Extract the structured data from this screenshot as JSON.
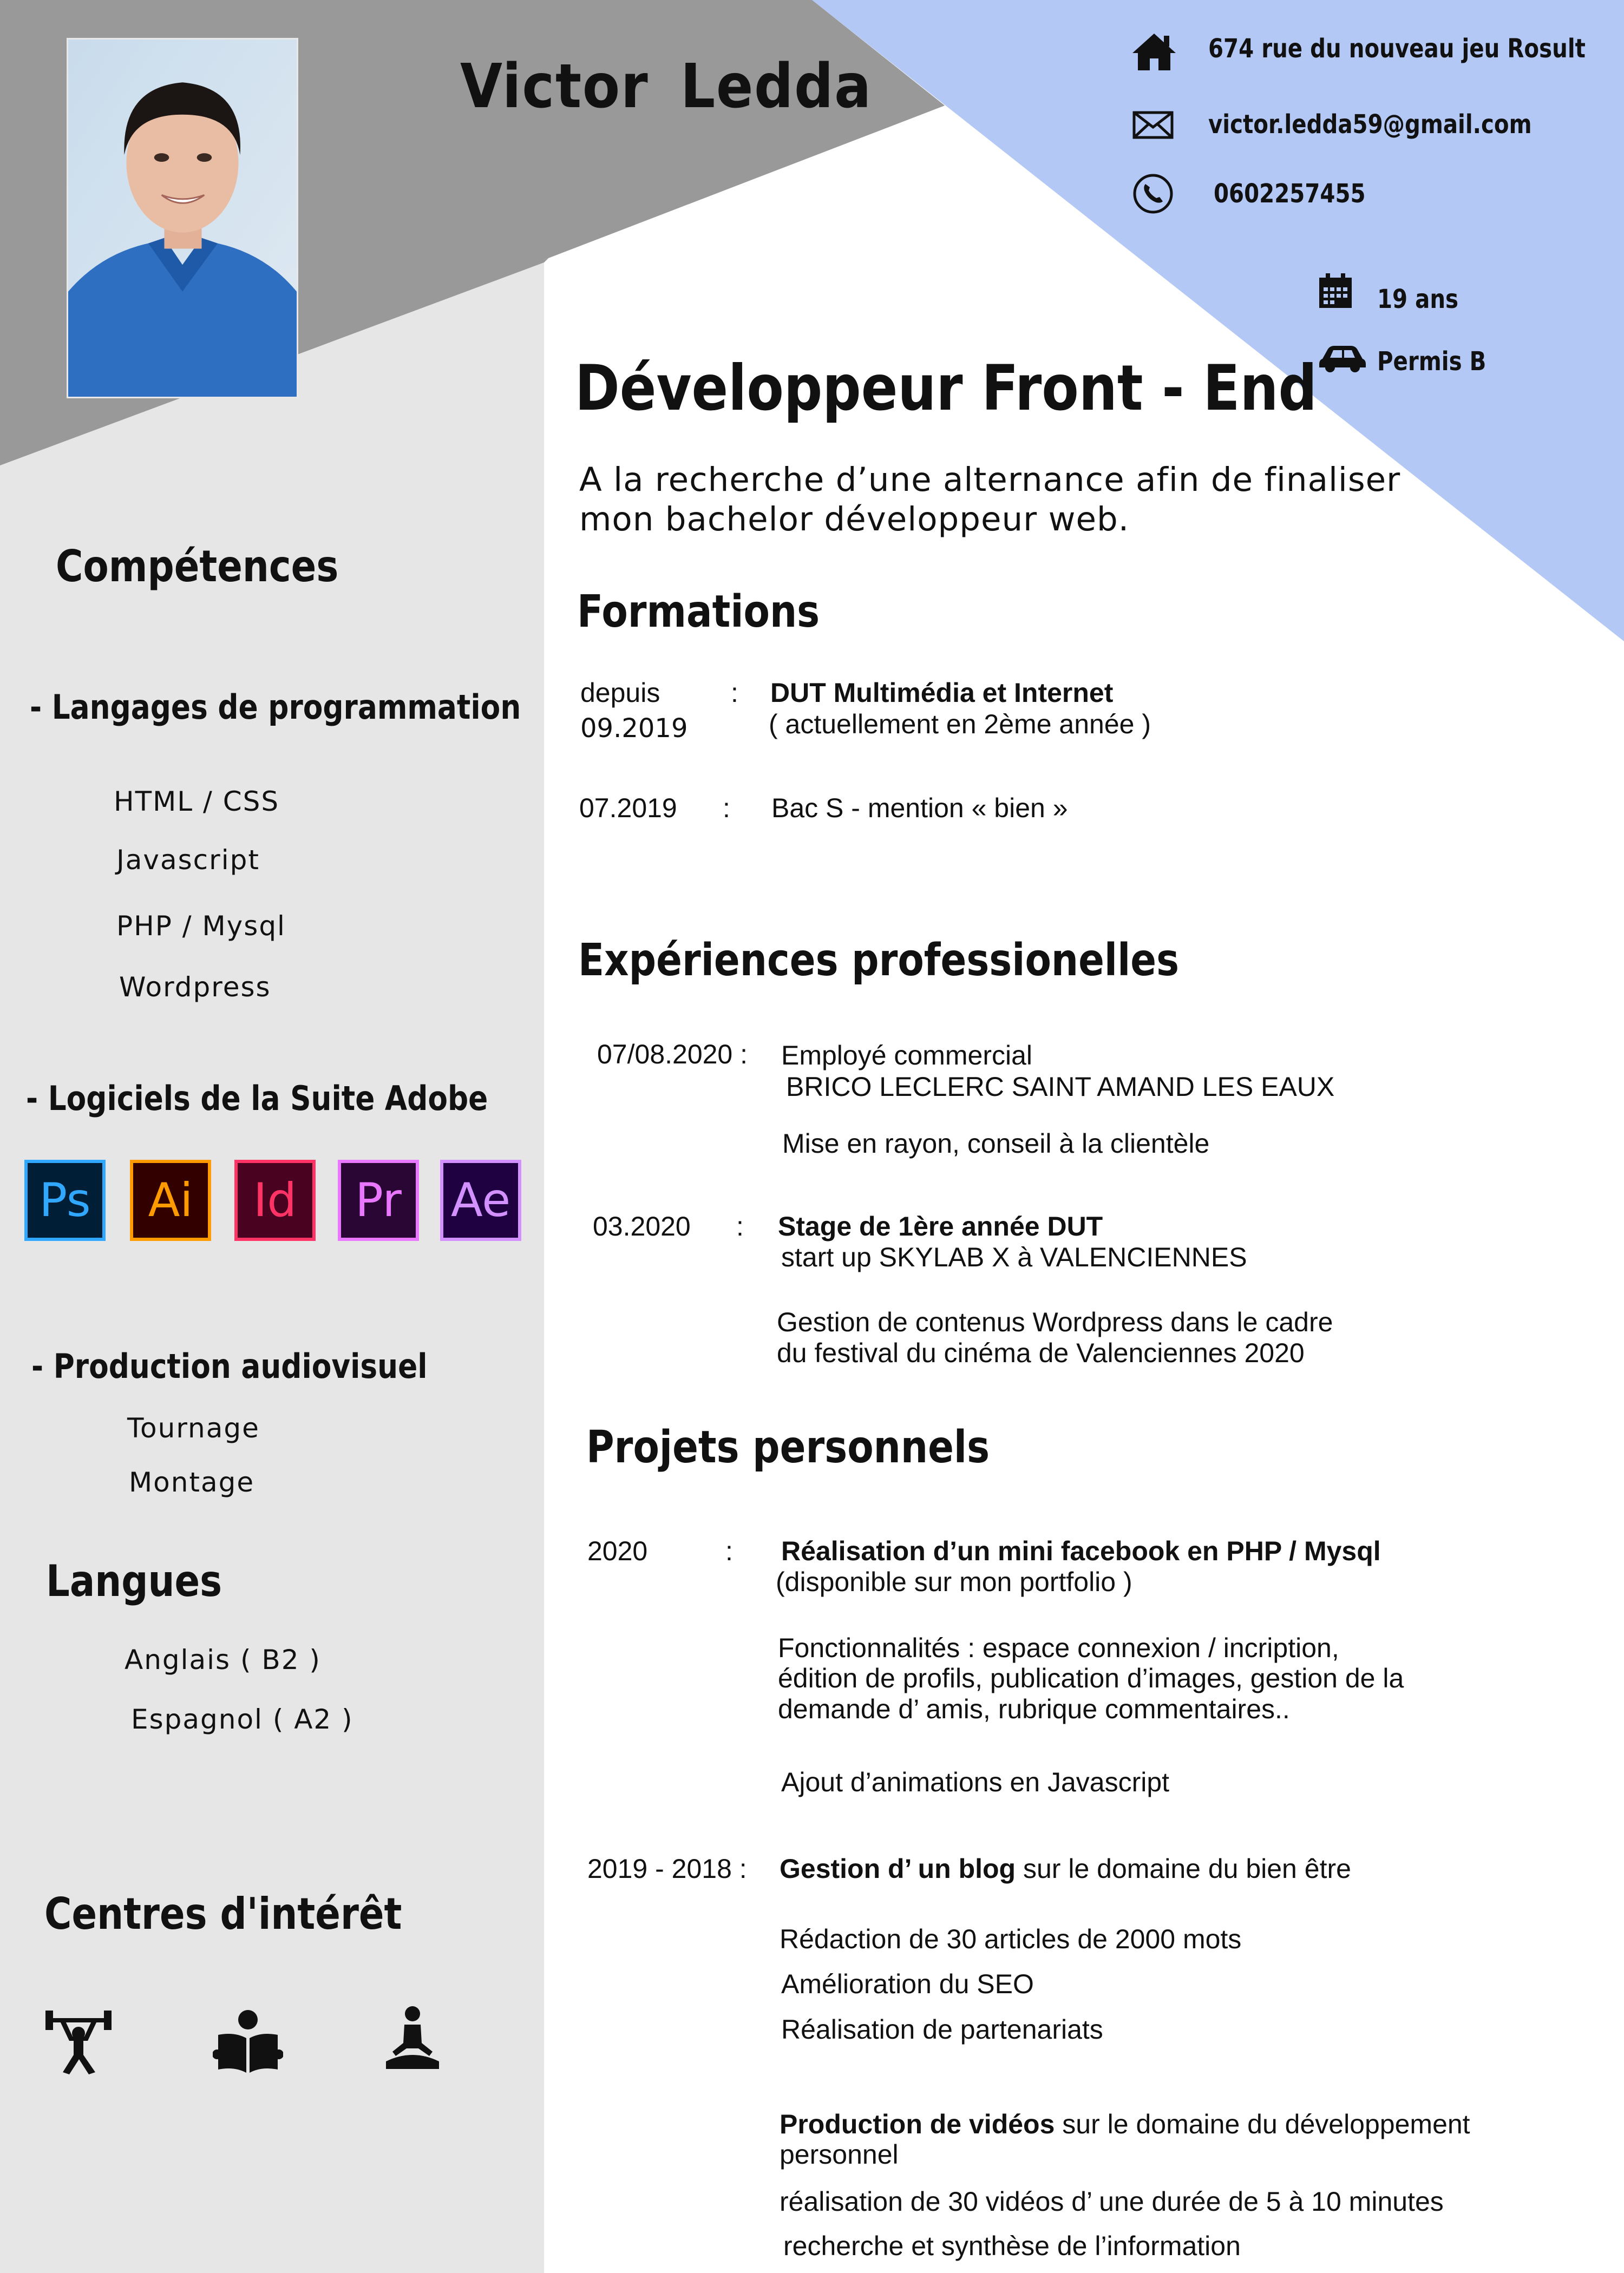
{
  "header": {
    "name": "Victor  Ledda",
    "job_title": "Développeur Front - End",
    "tagline_line1": "A la recherche d’une alternance afin de finaliser",
    "tagline_line2": "mon bachelor développeur web."
  },
  "contact": {
    "address": "674 rue du nouveau jeu Rosult",
    "email": "victor.ledda59@gmail.com",
    "phone": "0602257455",
    "age": "19 ans",
    "license": "Permis B"
  },
  "skills": {
    "heading": "Compétences",
    "programming_heading": "- Langages de programmation",
    "programming": [
      "HTML / CSS",
      "Javascript",
      "PHP / Mysql",
      "Wordpress"
    ],
    "adobe_heading": "- Logiciels de la Suite Adobe",
    "adobe": [
      {
        "label": "Ps",
        "color": "#31a8ff",
        "bg": "#001e36"
      },
      {
        "label": "Ai",
        "color": "#ff9a00",
        "bg": "#330000"
      },
      {
        "label": "Id",
        "color": "#ff3366",
        "bg": "#49021f"
      },
      {
        "label": "Pr",
        "color": "#ea77ff",
        "bg": "#2a0634"
      },
      {
        "label": "Ae",
        "color": "#d291ff",
        "bg": "#1f0040"
      }
    ],
    "av_heading": "- Production audiovisuel",
    "av": [
      "Tournage",
      "Montage"
    ]
  },
  "languages": {
    "heading": "Langues",
    "items": [
      "Anglais ( B2 )",
      "Espagnol ( A2 )"
    ]
  },
  "interests": {
    "heading": "Centres d'intérêt",
    "icons": [
      "weightlifting-icon",
      "reading-icon",
      "meditation-icon"
    ]
  },
  "formations": {
    "heading": "Formations",
    "items": [
      {
        "date1": "depuis",
        "date2": "09.2019",
        "sep": ":",
        "title": "DUT Multimédia et Internet",
        "detail": "( actuellement en 2ème année )"
      },
      {
        "date1": "07.2019",
        "sep": ":",
        "title": "Bac S - mention « bien »"
      }
    ]
  },
  "experiences": {
    "heading": "Expériences professionelles",
    "items": [
      {
        "date": "07/08.2020 :",
        "title": "Employé commercial",
        "company": "BRICO LECLERC SAINT AMAND LES EAUX",
        "desc1": "Mise en rayon, conseil à la clientèle"
      },
      {
        "date": "03.2020",
        "sep": ":",
        "title": "Stage de 1ère année DUT",
        "company": "start up SKYLAB X à VALENCIENNES",
        "desc1": "Gestion de contenus Wordpress dans le cadre",
        "desc2": "du festival du cinéma de Valenciennes 2020"
      }
    ]
  },
  "projects": {
    "heading": "Projets personnels",
    "p1": {
      "date": "2020",
      "sep": ":",
      "title": "Réalisation d’un mini facebook en PHP / Mysql",
      "subtitle": "(disponible sur mon portfolio )",
      "desc": [
        "Fonctionnalités : espace connexion / incription,",
        "édition de profils, publication d’images, gestion de la",
        "demande d’ amis, rubrique commentaires.."
      ],
      "extra": "Ajout d’animations en Javascript"
    },
    "p2": {
      "date": "2019 - 2018 :",
      "title_bold": "Gestion d’ un blog",
      "title_rest": " sur le domaine du bien être",
      "items": [
        "Rédaction de 30 articles de 2000 mots",
        "Amélioration du SEO",
        "Réalisation de partenariats"
      ]
    },
    "p3": {
      "title_bold": "Production de vidéos",
      "title_rest": " sur le domaine du développement",
      "title_line2": "personnel",
      "items": [
        "réalisation de 30 vidéos d’ une durée de 5 à 10 minutes",
        "recherche et synthèse de l’information"
      ]
    }
  },
  "colors": {
    "sidebar": "#e6e6e6",
    "header_gray": "#999999",
    "accent_blue": "#b4c8f5"
  }
}
